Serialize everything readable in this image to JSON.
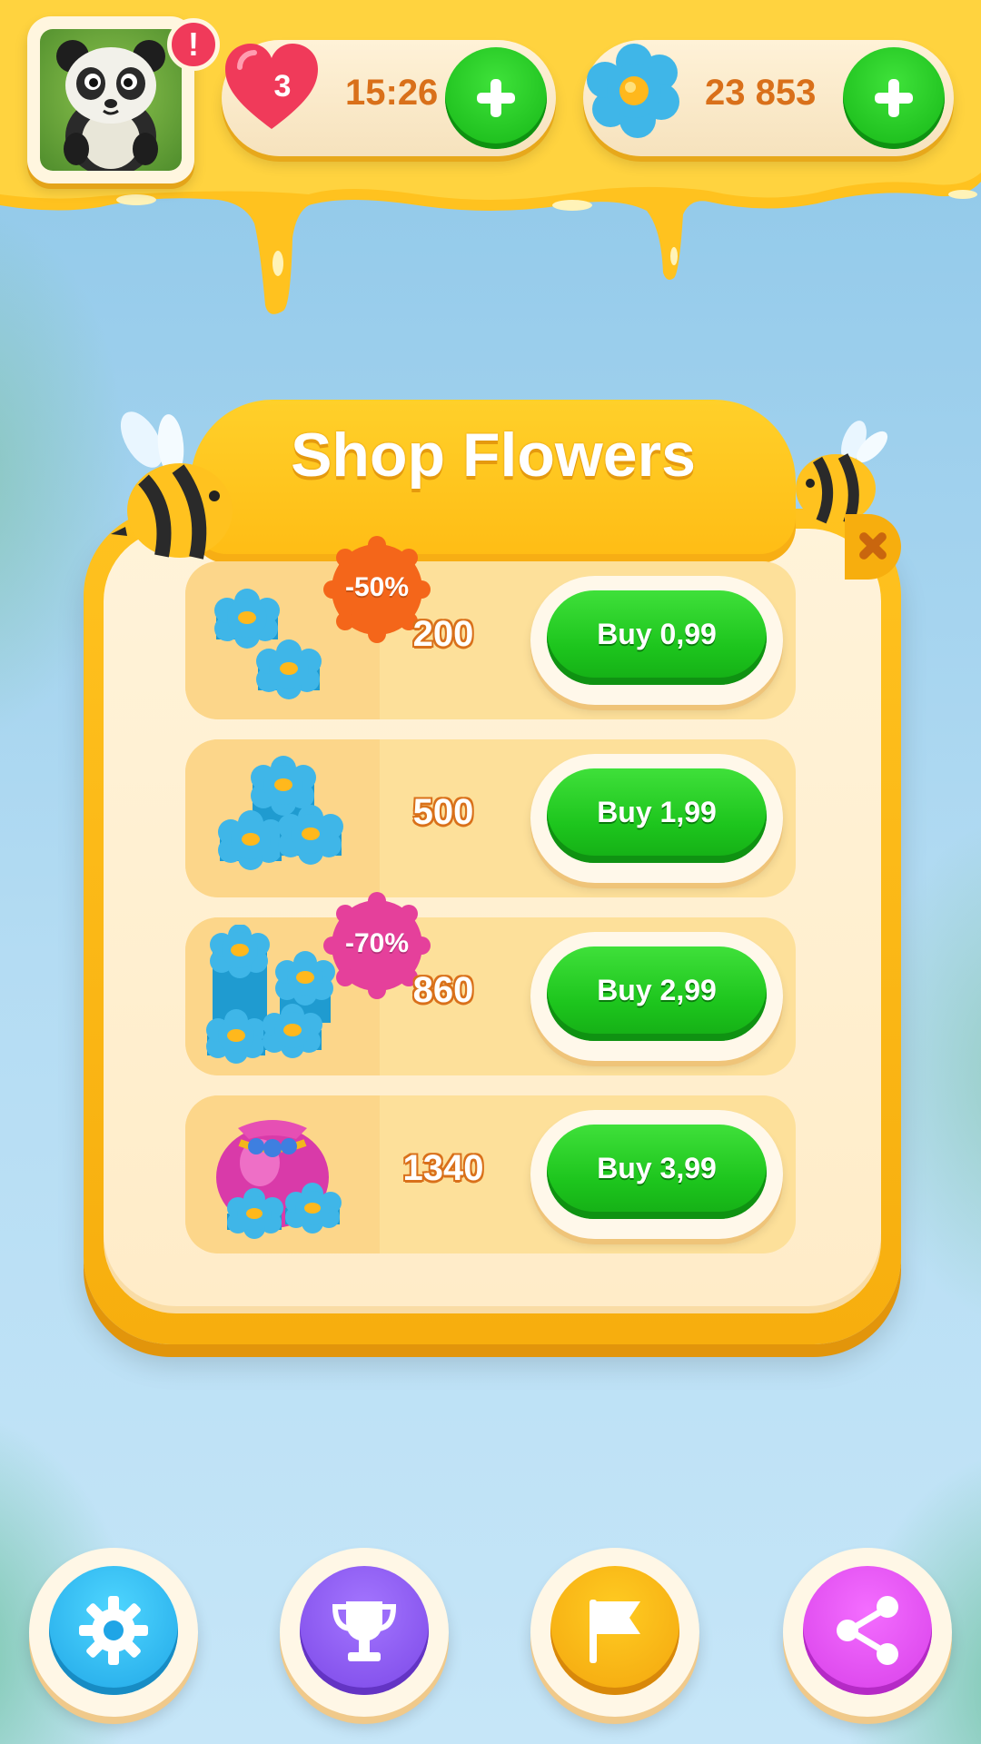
{
  "header": {
    "alert_mark": "!",
    "lives": {
      "count": "3",
      "timer": "15:26"
    },
    "flowers": {
      "count": "23 853"
    }
  },
  "shop": {
    "title": "Shop Flowers",
    "items": [
      {
        "amount": "200",
        "price_label": "Buy 0,99",
        "discount": "-50%",
        "discount_color": "#f4661a",
        "art": "small-flower-stack-icon"
      },
      {
        "amount": "500",
        "price_label": "Buy 1,99",
        "discount": "",
        "art": "medium-flower-stack-icon"
      },
      {
        "amount": "860",
        "price_label": "Buy 2,99",
        "discount": "-70%",
        "discount_color": "#e5409b",
        "art": "large-flower-stack-icon"
      },
      {
        "amount": "1340",
        "price_label": "Buy 3,99",
        "discount": "",
        "art": "flower-sack-icon"
      }
    ]
  },
  "nav": {
    "icons": [
      "gear-icon",
      "trophy-icon",
      "flag-icon",
      "share-icon"
    ]
  },
  "colors": {
    "honey": "#ffc21f",
    "button_green": "#1dc51d",
    "text_orange": "#d9701a",
    "heart": "#f03a5a",
    "flower_blue": "#3fb6e8"
  }
}
